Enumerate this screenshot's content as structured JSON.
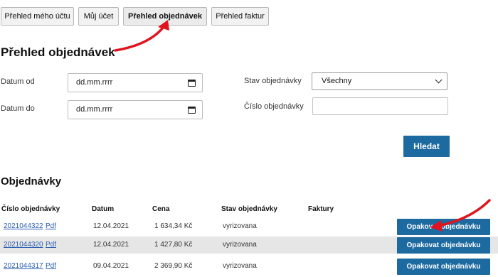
{
  "tabs": [
    {
      "label": "Přehled mého účtu"
    },
    {
      "label": "Můj účet"
    },
    {
      "label": "Přehled objednávek"
    },
    {
      "label": "Přehled faktur"
    }
  ],
  "page_title": "Přehled objednávek",
  "filters": {
    "date_from_label": "Datum od",
    "date_from_placeholder": "dd.mm.rrrr",
    "date_to_label": "Datum do",
    "date_to_placeholder": "dd.mm.rrrr",
    "status_label": "Stav objednávky",
    "status_value": "Všechny",
    "order_number_label": "Číslo objednávky",
    "order_number_value": "",
    "search_button": "Hledat"
  },
  "orders": {
    "title": "Objednávky",
    "columns": [
      "Číslo objednávky",
      "Datum",
      "Cena",
      "Stav objednávky",
      "Faktury"
    ],
    "rows": [
      {
        "number": "2021044322",
        "pdf": "Pdf",
        "date": "12.04.2021",
        "price": "1 634,34 Kč",
        "status": "vyrizovana",
        "action": "Opakovat objednávku"
      },
      {
        "number": "2021044320",
        "pdf": "Pdf",
        "date": "12.04.2021",
        "price": "1 427,80 Kč",
        "status": "vyrizovana",
        "action": "Opakovat objednávku"
      },
      {
        "number": "2021044317",
        "pdf": "Pdf",
        "date": "09.04.2021",
        "price": "2 369,90 Kč",
        "status": "vyrizovana",
        "action": "Opakovat objednávku"
      }
    ]
  },
  "colors": {
    "accent": "#1c6aa0",
    "annotation": "#e0141e",
    "link": "#2a5db0",
    "alt_row": "#e6e6e6"
  },
  "icons": {
    "date_picker": "calendar-icon",
    "select": "chevron-down-icon",
    "annotation": "red-arrow"
  }
}
